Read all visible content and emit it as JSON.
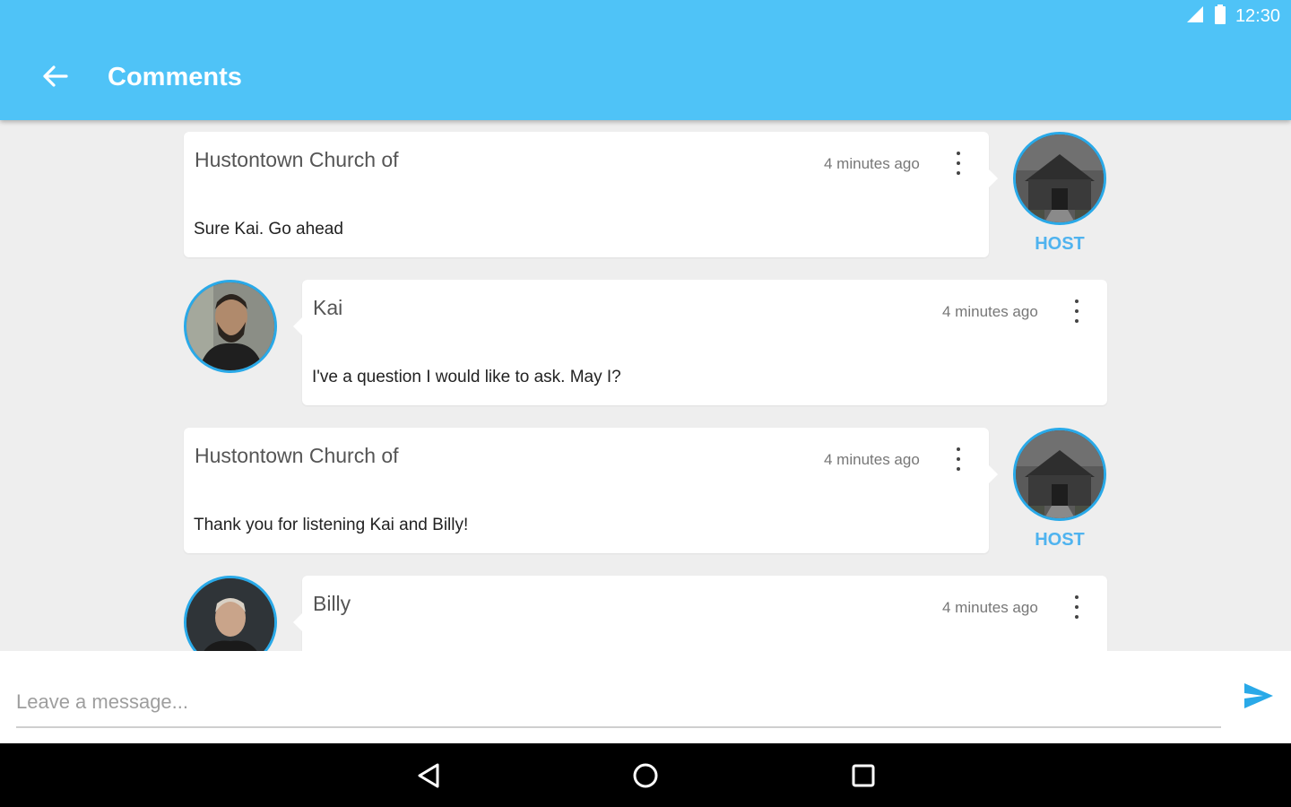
{
  "status_bar": {
    "time": "12:30"
  },
  "app_bar": {
    "title": "Comments"
  },
  "comments": [
    {
      "author": "Hustontown Church of",
      "time": "4 minutes ago",
      "text": "Sure Kai. Go ahead",
      "role": "HOST"
    },
    {
      "author": "Kai",
      "time": "4 minutes ago",
      "text": "I've a question I would like to ask. May I?"
    },
    {
      "author": "Hustontown Church of",
      "time": "4 minutes ago",
      "text": "Thank you for listening Kai and Billy!",
      "role": "HOST"
    },
    {
      "author": "Billy",
      "time": "4 minutes ago",
      "text": ""
    }
  ],
  "composer": {
    "placeholder": "Leave a message..."
  },
  "colors": {
    "app_bar": "#4fc3f7",
    "accent": "#29a9e8",
    "host_label": "#4fb3ef"
  }
}
